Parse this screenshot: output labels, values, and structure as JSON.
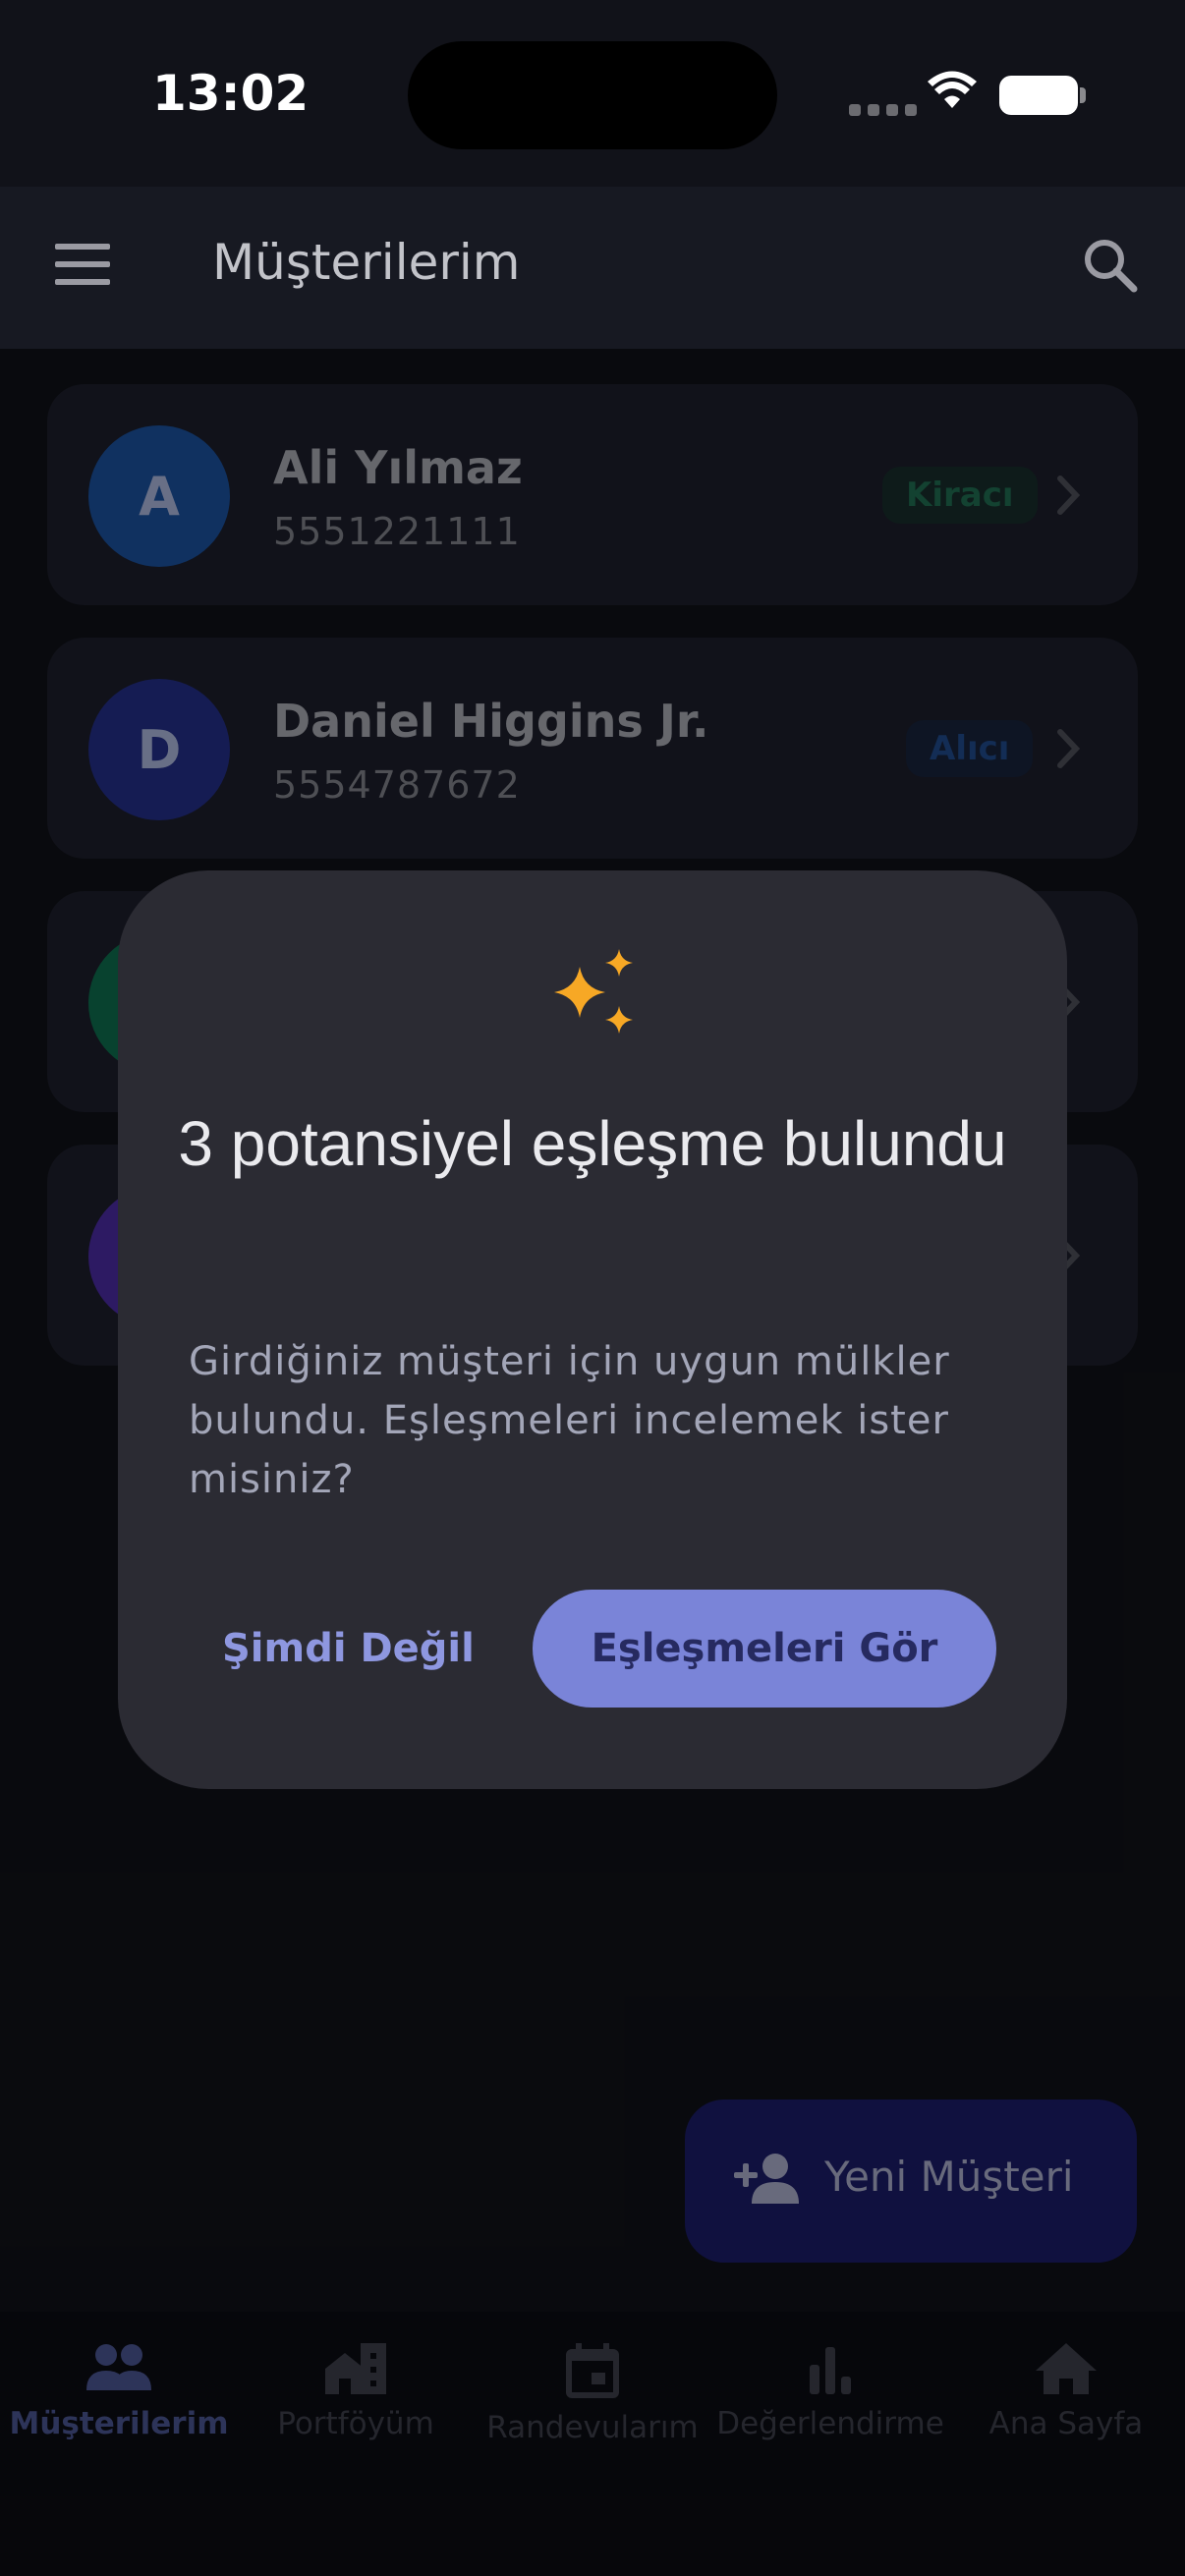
{
  "status_bar": {
    "time": "13:02"
  },
  "app_bar": {
    "title": "Müşterilerim",
    "menu_icon": "menu-icon",
    "search_icon": "search-icon"
  },
  "customers": [
    {
      "initial": "A",
      "name": "Ali Yılmaz",
      "phone": "5551221111",
      "badge": "Kiracı",
      "avatar_color": "#1a4f9c",
      "badge_color": "#1f6b4f"
    },
    {
      "initial": "D",
      "name": "Daniel Higgins Jr.",
      "phone": "5554787672",
      "badge": "Alıcı",
      "avatar_color": "#232e86",
      "badge_color": "#1f4a8a"
    },
    {
      "avatar_color": "#0e6b4c"
    },
    {
      "avatar_color": "#4a2aa0"
    }
  ],
  "dialog": {
    "icon": "sparkle-icon",
    "title": "3 potansiyel eşleşme bulundu",
    "body": "Girdiğiniz müşteri için uygun mülkler bulundu. Eşleşmeleri incelemek ister misiniz?",
    "secondary_button": "Şimdi Değil",
    "primary_button": "Eşleşmeleri Gör"
  },
  "fab": {
    "label": "Yeni Müşteri",
    "icon": "person-add-icon"
  },
  "bottom_nav": [
    {
      "label": "Müşterilerim",
      "icon": "people-icon",
      "active": true
    },
    {
      "label": "Portföyüm",
      "icon": "buildings-icon",
      "active": false
    },
    {
      "label": "Randevularım",
      "icon": "calendar-icon",
      "active": false
    },
    {
      "label": "Değerlendirme",
      "icon": "bar-chart-icon",
      "active": false
    },
    {
      "label": "Ana Sayfa",
      "icon": "home-icon",
      "active": false
    }
  ]
}
